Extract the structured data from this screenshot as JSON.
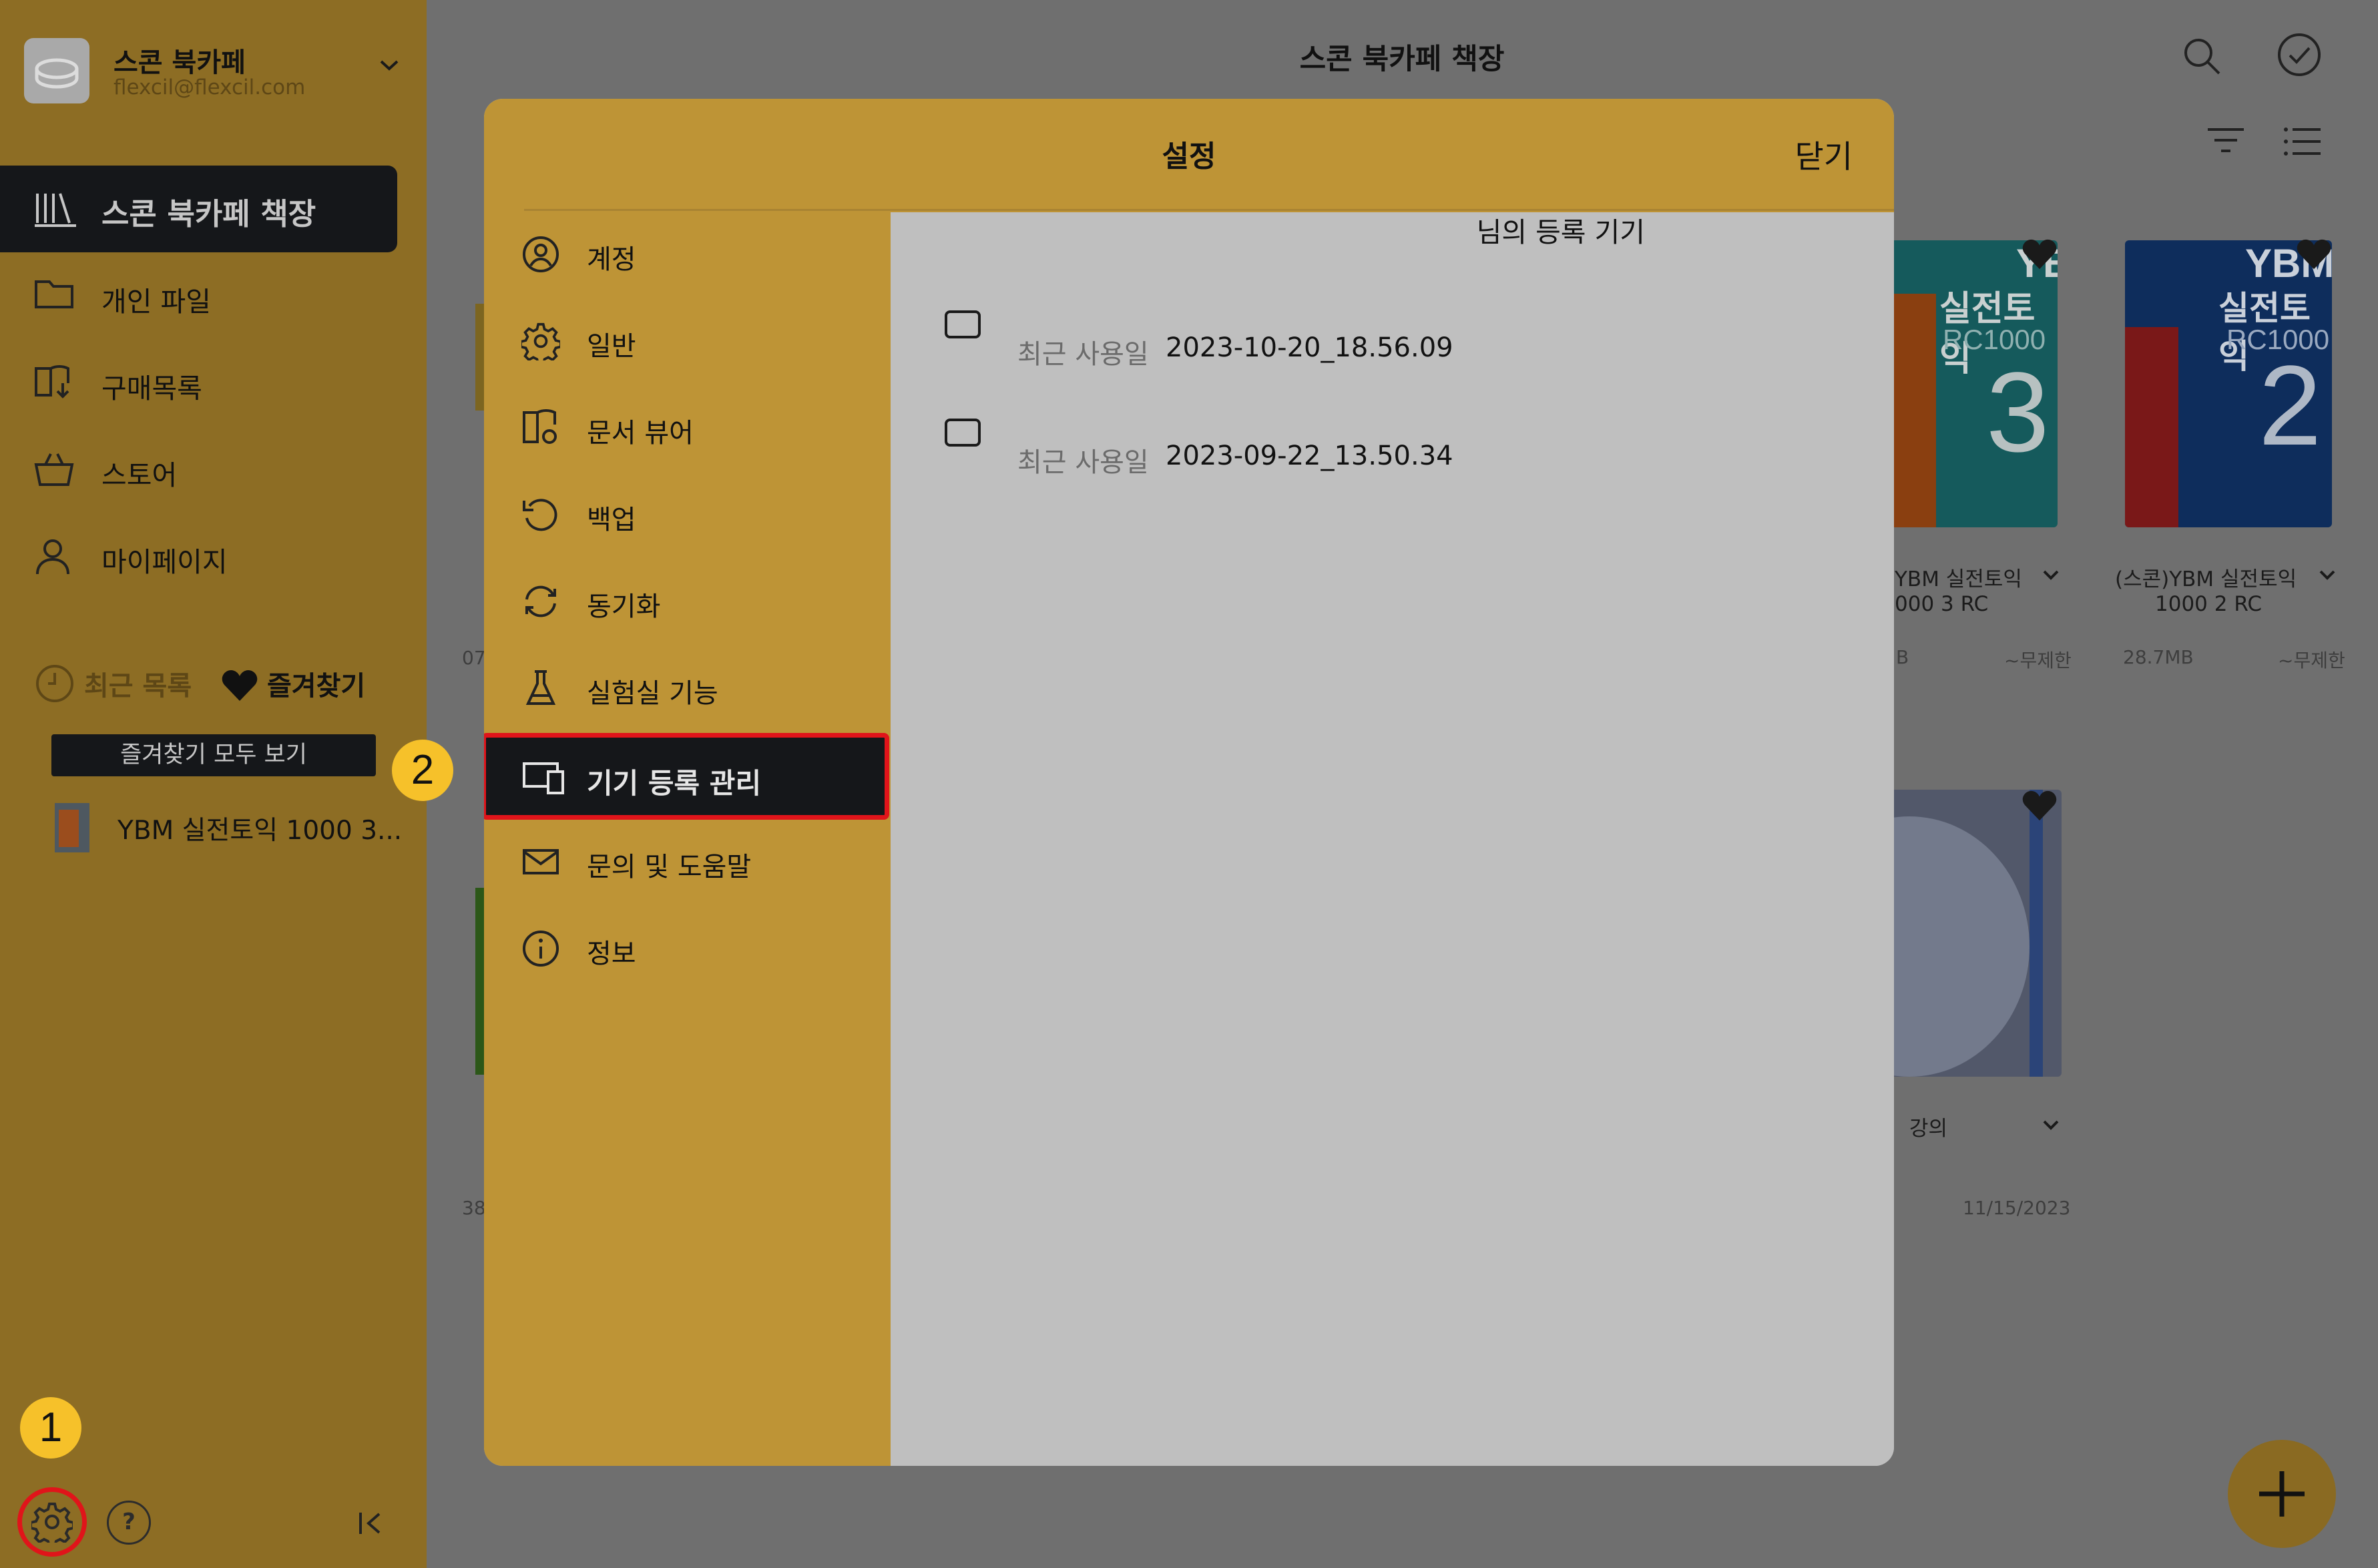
{
  "sidebar": {
    "account_name": "스콘 북카페",
    "account_email": "flexcil@flexcil.com",
    "nav": [
      {
        "label": "스콘 북카페 책장"
      },
      {
        "label": "개인 파일"
      },
      {
        "label": "구매목록"
      },
      {
        "label": "스토어"
      },
      {
        "label": "마이페이지"
      }
    ],
    "recent_label": "최근 목록",
    "favorites_label": "즐겨찾기",
    "favorites_all": "즐겨찾기 모두 보기",
    "favorite_item": "YBM 실전토익 1000 3...",
    "help_glyph": "?"
  },
  "main": {
    "title": "스콘 북카페 책장",
    "books": [
      {
        "caption_1": "YBM 실전토익",
        "caption_2": "000 3 RC",
        "size": "B",
        "expiry": "~무제한"
      },
      {
        "caption_1": "(스콘)YBM 실전토익",
        "caption_2": "1000 2 RC",
        "size": "28.7MB",
        "expiry": "~무제한"
      },
      {
        "caption_1": "강의",
        "size": "",
        "date": "11/15/2023"
      }
    ],
    "partial_left_1": "07",
    "partial_left_2": "38",
    "cover_texts": {
      "b1_brand": "YB",
      "b1_line1": "실전토익",
      "b1_line2": "RC1000",
      "b1_num": "3",
      "b2_brand": "YBM",
      "b2_line1": "실전토익",
      "b2_line2": "RC1000",
      "b2_num": "2"
    }
  },
  "badges": {
    "one": "1",
    "two": "2"
  },
  "modal": {
    "title": "설정",
    "close": "닫기",
    "menu": [
      {
        "label": "계정"
      },
      {
        "label": "일반"
      },
      {
        "label": "문서 뷰어"
      },
      {
        "label": "백업"
      },
      {
        "label": "동기화"
      },
      {
        "label": "실험실 기능"
      },
      {
        "label": "기기 등록 관리"
      },
      {
        "label": "문의 및 도움말"
      },
      {
        "label": "정보"
      }
    ],
    "devices_title": "님의 등록 기기",
    "devices": [
      {
        "label": "최근 사용일",
        "value": "2023-10-20_18.56.09"
      },
      {
        "label": "최근 사용일",
        "value": "2023-09-22_13.50.34"
      }
    ]
  },
  "colors": {
    "sidebar_bg": "#8d6d24",
    "modal_gold": "#be9436",
    "active_bg": "#15171a",
    "highlight_red": "#e0141a",
    "badge_yellow": "#f6c12a"
  }
}
